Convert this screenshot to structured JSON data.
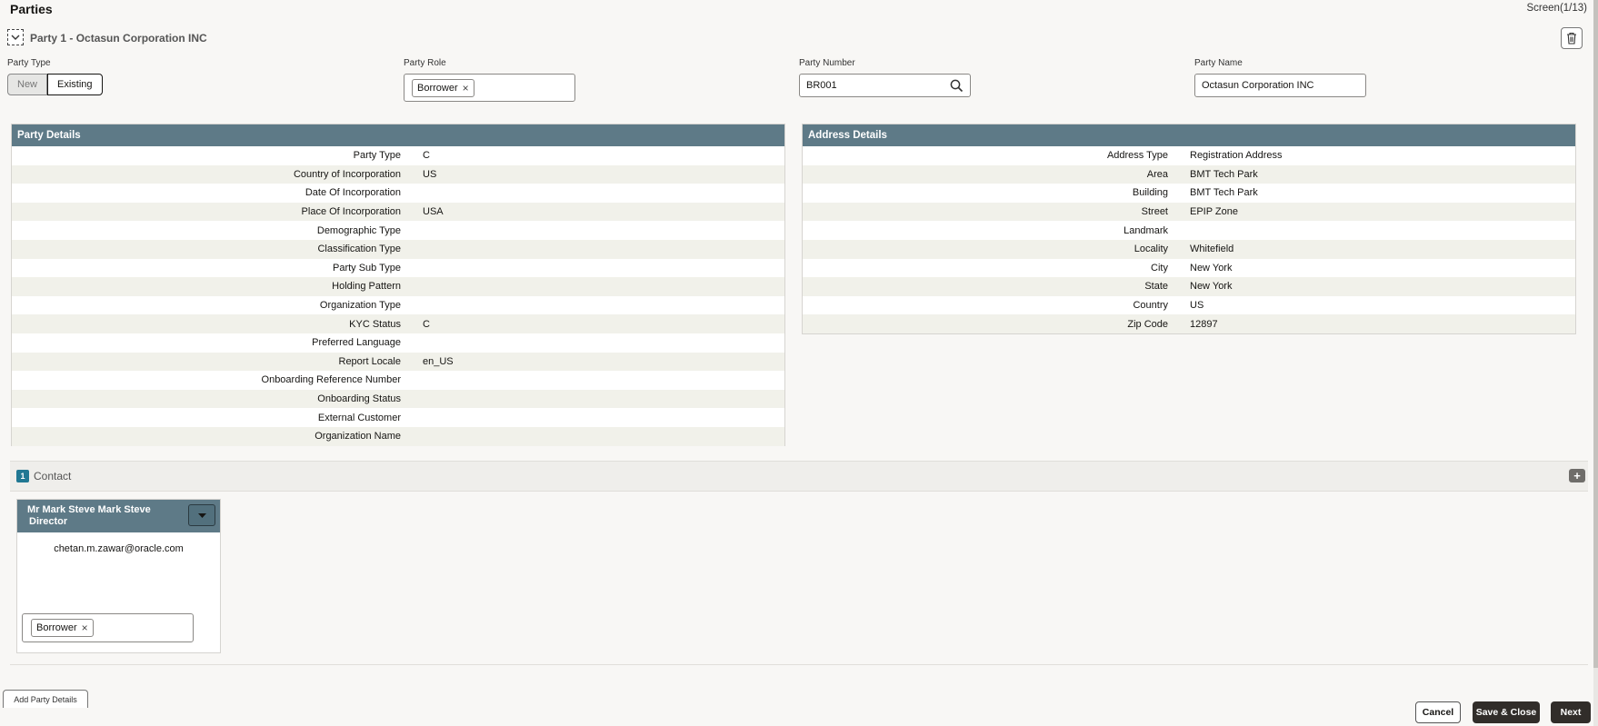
{
  "page": {
    "title": "Parties",
    "screen_indicator": "Screen(1/13)"
  },
  "party": {
    "header": "Party 1  -  Octasun Corporation INC"
  },
  "fields": {
    "party_type_label": "Party Type",
    "party_type_new": "New",
    "party_type_existing": "Existing",
    "party_role_label": "Party Role",
    "party_role_chip": "Borrower",
    "party_number_label": "Party Number",
    "party_number_value": "BR001",
    "party_name_label": "Party Name",
    "party_name_value": "Octasun Corporation INC"
  },
  "party_details": {
    "title": "Party Details",
    "rows": [
      {
        "label": "Party Type",
        "value": "C"
      },
      {
        "label": "Country of Incorporation",
        "value": "US"
      },
      {
        "label": "Date Of Incorporation",
        "value": ""
      },
      {
        "label": "Place Of Incorporation",
        "value": "USA"
      },
      {
        "label": "Demographic Type",
        "value": ""
      },
      {
        "label": "Classification Type",
        "value": ""
      },
      {
        "label": "Party Sub Type",
        "value": ""
      },
      {
        "label": "Holding Pattern",
        "value": ""
      },
      {
        "label": "Organization Type",
        "value": ""
      },
      {
        "label": "KYC Status",
        "value": "C"
      },
      {
        "label": "Preferred Language",
        "value": ""
      },
      {
        "label": "Report Locale",
        "value": "en_US"
      },
      {
        "label": "Onboarding Reference Number",
        "value": ""
      },
      {
        "label": "Onboarding Status",
        "value": ""
      },
      {
        "label": "External Customer",
        "value": ""
      },
      {
        "label": "Organization Name",
        "value": ""
      }
    ]
  },
  "address_details": {
    "title": "Address Details",
    "rows": [
      {
        "label": "Address Type",
        "value": "Registration Address"
      },
      {
        "label": "Area",
        "value": "BMT Tech Park"
      },
      {
        "label": "Building",
        "value": "BMT Tech Park"
      },
      {
        "label": "Street",
        "value": "EPIP Zone"
      },
      {
        "label": "Landmark",
        "value": ""
      },
      {
        "label": "Locality",
        "value": "Whitefield"
      },
      {
        "label": "City",
        "value": "New York"
      },
      {
        "label": "State",
        "value": "New York"
      },
      {
        "label": "Country",
        "value": "US"
      },
      {
        "label": "Zip Code",
        "value": "12897"
      }
    ]
  },
  "contact": {
    "count": "1",
    "label": "Contact",
    "card": {
      "name": "Mr  Mark Steve  Mark Steve",
      "role": "Director",
      "email": "chetan.m.zawar@oracle.com",
      "role_chip": "Borrower"
    }
  },
  "actions": {
    "add_party": "Add Party Details",
    "cancel": "Cancel",
    "save_close": "Save & Close",
    "next": "Next"
  },
  "icons": {
    "collapse": "chevron-down-icon",
    "delete": "trash-icon",
    "search": "search-icon",
    "add": "plus-icon",
    "dropdown": "caret-down-icon",
    "remove": "x-icon"
  },
  "colors": {
    "panel_header": "#5e7a87",
    "badge": "#217893",
    "primary_button": "#312d2a"
  }
}
